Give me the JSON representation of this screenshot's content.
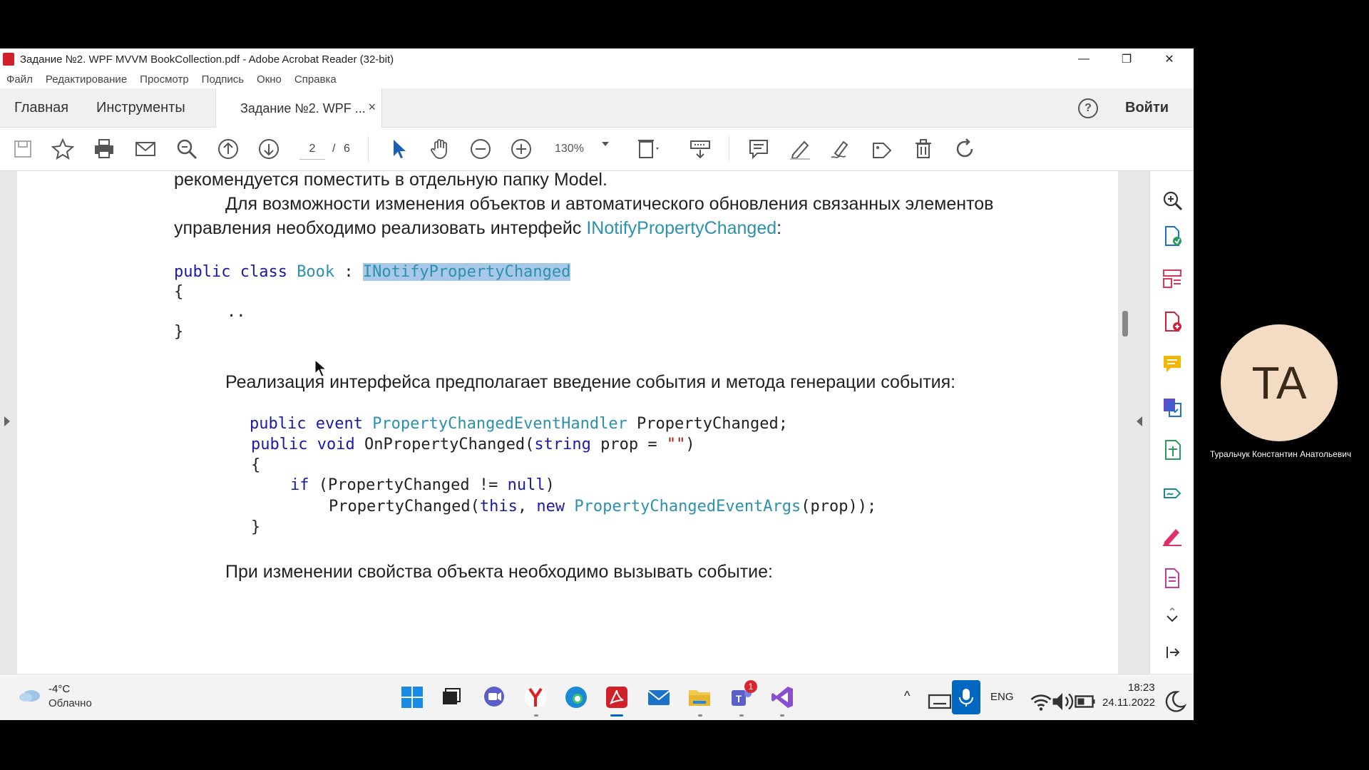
{
  "window": {
    "title": "Задание №2. WPF MVVM BookCollection.pdf - Adobe Acrobat Reader (32-bit)",
    "minimize": "—",
    "restore": "❐",
    "close": "✕"
  },
  "menu": {
    "items": [
      "Файл",
      "Редактирование",
      "Просмотр",
      "Подпись",
      "Окно",
      "Справка"
    ]
  },
  "tabs": {
    "home": "Главная",
    "tools": "Инструменты",
    "document": "Задание №2. WPF ...",
    "document_close": "×",
    "help": "?",
    "signin": "Войти"
  },
  "toolbar": {
    "page_current": "2",
    "page_sep": "/",
    "page_total": "6",
    "zoom": "130%"
  },
  "document": {
    "line1": "рекомендуется поместить в отдельную папку Model.",
    "line2": "Для возможности изменения объектов и автоматического обновления связанных элементов",
    "line3_prefix": "управления необходимо реализовать интерфейс ",
    "line3_link": "INotifyPropertyChanged",
    "line3_suffix": ":",
    "code1": {
      "kw": "public class ",
      "type": "Book",
      "sep": " : ",
      "iface": "INotifyPropertyChanged",
      "open": "{",
      "dots": "..",
      "close": "}"
    },
    "para2": "Реализация интерфейса предполагает введение события и метода генерации события:",
    "code2": {
      "l1_kw": "public event ",
      "l1_type": "PropertyChangedEventHandler",
      "l1_rest": " PropertyChanged;",
      "l2_kw": "public void ",
      "l2_a": "OnPropertyChanged(",
      "l2_kw2": "string",
      "l2_b": " prop = ",
      "l2_str": "\"\"",
      "l2_c": ")",
      "l3": "{",
      "l4_kw": "if",
      "l4_a": " (PropertyChanged != ",
      "l4_kw2": "null",
      "l4_b": ")",
      "l5_a": "PropertyChanged(",
      "l5_kw": "this",
      "l5_b": ", ",
      "l5_kw2": "new",
      "l5_c": " ",
      "l5_type": "PropertyChangedEventArgs",
      "l5_d": "(prop));",
      "l6": "}"
    },
    "para3": "При изменении свойства объекта необходимо вызывать событие:"
  },
  "taskbar": {
    "temp": "-4°C",
    "weather": "Облачно",
    "lang": "ENG",
    "time": "18:23",
    "date": "24.11.2022",
    "teams_badge": "1"
  },
  "participant": {
    "initials": "TA",
    "name": "Туральчук Константин Анатольевич"
  },
  "colors": {
    "accent": "#0067c0",
    "code_keyword": "#1a1aa6",
    "code_type": "#2b91af",
    "selection": "#a8c8e8",
    "acrobat_red": "#d0202a"
  }
}
